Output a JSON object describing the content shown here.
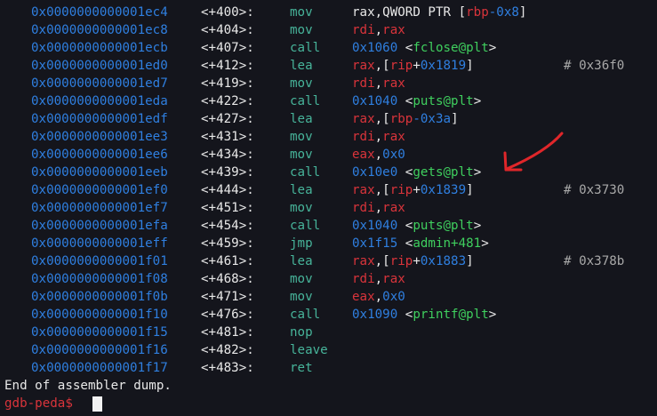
{
  "lines": [
    {
      "addr": "0x0000000000001ec4",
      "off": "<+400>:",
      "mn": "mov",
      "ops": [
        [
          "plain",
          "rax,QWORD PTR ["
        ],
        [
          "reg",
          "rbp"
        ],
        [
          "num",
          "-0x8"
        ],
        [
          "plain",
          "]"
        ]
      ],
      "cm": ""
    },
    {
      "addr": "0x0000000000001ec8",
      "off": "<+404>:",
      "mn": "mov",
      "ops": [
        [
          "reg",
          "rdi"
        ],
        [
          "plain",
          ","
        ],
        [
          "reg",
          "rax"
        ]
      ],
      "cm": ""
    },
    {
      "addr": "0x0000000000001ecb",
      "off": "<+407>:",
      "mn": "call",
      "ops": [
        [
          "num",
          "0x1060"
        ],
        [
          "plain",
          " <"
        ],
        [
          "sym",
          "fclose@plt"
        ],
        [
          "plain",
          ">"
        ]
      ],
      "cm": ""
    },
    {
      "addr": "0x0000000000001ed0",
      "off": "<+412>:",
      "mn": "lea",
      "ops": [
        [
          "reg",
          "rax"
        ],
        [
          "plain",
          ",["
        ],
        [
          "reg",
          "rip"
        ],
        [
          "plain",
          "+"
        ],
        [
          "num",
          "0x1819"
        ],
        [
          "plain",
          "]"
        ]
      ],
      "cm": "# 0x36f0"
    },
    {
      "addr": "0x0000000000001ed7",
      "off": "<+419>:",
      "mn": "mov",
      "ops": [
        [
          "reg",
          "rdi"
        ],
        [
          "plain",
          ","
        ],
        [
          "reg",
          "rax"
        ]
      ],
      "cm": ""
    },
    {
      "addr": "0x0000000000001eda",
      "off": "<+422>:",
      "mn": "call",
      "ops": [
        [
          "num",
          "0x1040"
        ],
        [
          "plain",
          " <"
        ],
        [
          "sym",
          "puts@plt"
        ],
        [
          "plain",
          ">"
        ]
      ],
      "cm": ""
    },
    {
      "addr": "0x0000000000001edf",
      "off": "<+427>:",
      "mn": "lea",
      "ops": [
        [
          "reg",
          "rax"
        ],
        [
          "plain",
          ",["
        ],
        [
          "reg",
          "rbp"
        ],
        [
          "num",
          "-0x3a"
        ],
        [
          "plain",
          "]"
        ]
      ],
      "cm": ""
    },
    {
      "addr": "0x0000000000001ee3",
      "off": "<+431>:",
      "mn": "mov",
      "ops": [
        [
          "reg",
          "rdi"
        ],
        [
          "plain",
          ","
        ],
        [
          "reg",
          "rax"
        ]
      ],
      "cm": ""
    },
    {
      "addr": "0x0000000000001ee6",
      "off": "<+434>:",
      "mn": "mov",
      "ops": [
        [
          "reg",
          "eax"
        ],
        [
          "plain",
          ","
        ],
        [
          "num",
          "0x0"
        ]
      ],
      "cm": ""
    },
    {
      "addr": "0x0000000000001eeb",
      "off": "<+439>:",
      "mn": "call",
      "ops": [
        [
          "num",
          "0x10e0"
        ],
        [
          "plain",
          " <"
        ],
        [
          "sym",
          "gets@plt"
        ],
        [
          "plain",
          ">"
        ]
      ],
      "cm": ""
    },
    {
      "addr": "0x0000000000001ef0",
      "off": "<+444>:",
      "mn": "lea",
      "ops": [
        [
          "reg",
          "rax"
        ],
        [
          "plain",
          ",["
        ],
        [
          "reg",
          "rip"
        ],
        [
          "plain",
          "+"
        ],
        [
          "num",
          "0x1839"
        ],
        [
          "plain",
          "]"
        ]
      ],
      "cm": "# 0x3730"
    },
    {
      "addr": "0x0000000000001ef7",
      "off": "<+451>:",
      "mn": "mov",
      "ops": [
        [
          "reg",
          "rdi"
        ],
        [
          "plain",
          ","
        ],
        [
          "reg",
          "rax"
        ]
      ],
      "cm": ""
    },
    {
      "addr": "0x0000000000001efa",
      "off": "<+454>:",
      "mn": "call",
      "ops": [
        [
          "num",
          "0x1040"
        ],
        [
          "plain",
          " <"
        ],
        [
          "sym",
          "puts@plt"
        ],
        [
          "plain",
          ">"
        ]
      ],
      "cm": ""
    },
    {
      "addr": "0x0000000000001eff",
      "off": "<+459>:",
      "mn": "jmp",
      "ops": [
        [
          "num",
          "0x1f15"
        ],
        [
          "plain",
          " <"
        ],
        [
          "sym",
          "admin+481"
        ],
        [
          "plain",
          ">"
        ]
      ],
      "cm": ""
    },
    {
      "addr": "0x0000000000001f01",
      "off": "<+461>:",
      "mn": "lea",
      "ops": [
        [
          "reg",
          "rax"
        ],
        [
          "plain",
          ",["
        ],
        [
          "reg",
          "rip"
        ],
        [
          "plain",
          "+"
        ],
        [
          "num",
          "0x1883"
        ],
        [
          "plain",
          "]"
        ]
      ],
      "cm": "# 0x378b"
    },
    {
      "addr": "0x0000000000001f08",
      "off": "<+468>:",
      "mn": "mov",
      "ops": [
        [
          "reg",
          "rdi"
        ],
        [
          "plain",
          ","
        ],
        [
          "reg",
          "rax"
        ]
      ],
      "cm": ""
    },
    {
      "addr": "0x0000000000001f0b",
      "off": "<+471>:",
      "mn": "mov",
      "ops": [
        [
          "reg",
          "eax"
        ],
        [
          "plain",
          ","
        ],
        [
          "num",
          "0x0"
        ]
      ],
      "cm": ""
    },
    {
      "addr": "0x0000000000001f10",
      "off": "<+476>:",
      "mn": "call",
      "ops": [
        [
          "num",
          "0x1090"
        ],
        [
          "plain",
          " <"
        ],
        [
          "sym",
          "printf@plt"
        ],
        [
          "plain",
          ">"
        ]
      ],
      "cm": ""
    },
    {
      "addr": "0x0000000000001f15",
      "off": "<+481>:",
      "mn": "nop",
      "ops": [],
      "cm": ""
    },
    {
      "addr": "0x0000000000001f16",
      "off": "<+482>:",
      "mn": "leave",
      "ops": [],
      "cm": ""
    },
    {
      "addr": "0x0000000000001f17",
      "off": "<+483>:",
      "mn": "ret",
      "ops": [],
      "cm": ""
    }
  ],
  "end_text": "End of assembler dump.",
  "prompt": "gdb-peda$ ",
  "annotation": {
    "icon": "red-arrow-icon",
    "color": "#e0262a"
  },
  "colors": {
    "background": "#14151c",
    "address": "#2f7fe0",
    "mnemonic": "#47b49a",
    "register": "#d9343b",
    "symbol": "#3fcf5e"
  }
}
